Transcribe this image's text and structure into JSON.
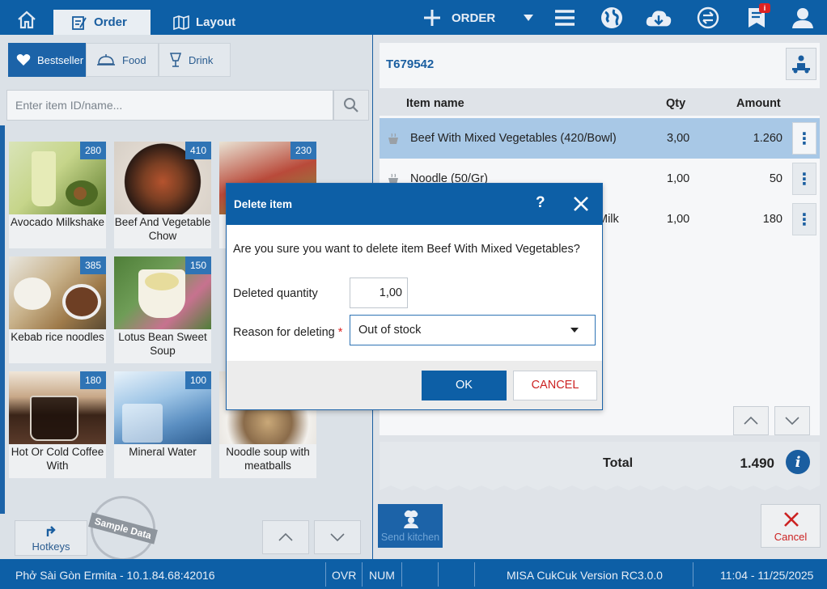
{
  "topbar": {
    "tabs": [
      {
        "label": "Order",
        "active": true
      },
      {
        "label": "Layout",
        "active": false
      }
    ],
    "order_label": "ORDER",
    "notification_badge": "i",
    "icons": [
      "home-icon",
      "add-icon",
      "dropdown-icon",
      "menu-icon",
      "globe-icon",
      "cloud-download-icon",
      "sync-icon",
      "notification-icon",
      "user-icon"
    ]
  },
  "categories": [
    {
      "label": "Bestseller",
      "icon": "heart-icon",
      "active": true
    },
    {
      "label": "Food",
      "icon": "cloche-icon",
      "active": false
    },
    {
      "label": "Drink",
      "icon": "drink-icon",
      "active": false
    }
  ],
  "search": {
    "placeholder": "Enter item ID/name...",
    "value": ""
  },
  "items": [
    {
      "name": "Avocado Milkshake",
      "price": "280",
      "color": "#c6d58a"
    },
    {
      "name": "Beef And Vegetable Chow",
      "price": "410",
      "color": "#7b3f23"
    },
    {
      "name": "",
      "price": "230",
      "color": "#b94a3a"
    },
    {
      "name": "Kebab rice noodles",
      "price": "385",
      "color": "#9e7a4a"
    },
    {
      "name": "Lotus Bean Sweet Soup",
      "price": "150",
      "color": "#6f9d57"
    },
    {
      "name": "Hot Or Cold Coffee With",
      "price": "180",
      "color": "#5a3a2a"
    },
    {
      "name": "Mineral Water",
      "price": "100",
      "color": "#5b8fc2"
    },
    {
      "name": "Noodle soup with meatballs",
      "price": "",
      "color": "#8a6b4a"
    }
  ],
  "left_footer": {
    "hotkeys_label": "Hotkeys",
    "stamp_text": "Sample Data"
  },
  "order": {
    "id": "T679542",
    "columns": {
      "name": "Item name",
      "qty": "Qty",
      "amount": "Amount"
    },
    "rows": [
      {
        "name": "Beef With Mixed Vegetables (420/Bowl)",
        "qty": "3,00",
        "amount": "1.260",
        "selected": true
      },
      {
        "name": "Noodle (50/Gr)",
        "qty": "1,00",
        "amount": "50",
        "selected": false
      },
      {
        "name": "Milk",
        "qty": "1,00",
        "amount": "180",
        "selected": false
      }
    ],
    "total_label": "Total",
    "total_value": "1.490",
    "send_kitchen_label": "Send kitchen",
    "cancel_label": "Cancel"
  },
  "modal": {
    "title": "Delete item",
    "help": "?",
    "message": "Are you sure you want to delete item Beef With Mixed Vegetables?",
    "qty_label": "Deleted quantity",
    "qty_value": "1,00",
    "reason_label": "Reason for deleting",
    "required_mark": "*",
    "reason_value": "Out of stock",
    "ok_label": "OK",
    "cancel_label": "CANCEL"
  },
  "statusbar": {
    "store": "Phở Sài Gòn Ermita - 10.1.84.68:42016",
    "ovr": "OVR",
    "num": "NUM",
    "version": "MISA CukCuk Version RC3.0.0",
    "datetime": "11:04 - 11/25/2025"
  }
}
